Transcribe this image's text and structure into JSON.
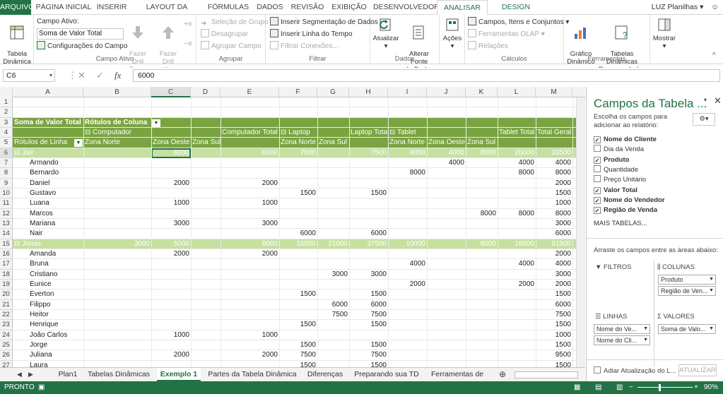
{
  "ribbon": {
    "tabs": [
      "ARQUIVO",
      "PÁGINA INICIAL",
      "INSERIR",
      "LAYOUT DA PÁGINA",
      "FÓRMULAS",
      "DADOS",
      "REVISÃO",
      "EXIBIÇÃO",
      "DESENVOLVEDOR",
      "ANALISAR",
      "DESIGN"
    ],
    "active_tab": "ANALISAR",
    "user": "LUZ Planilhas",
    "table_dynamic": "Tabela\nDinâmica",
    "campo_ativo_label": "Campo Ativo:",
    "campo_ativo_value": "Soma de Valor Total",
    "config_campo": "Configurações do Campo",
    "fazer_drill_down": "Fazer Drill\nDown",
    "fazer_drill_up": "Fazer Drill\nUp",
    "grp_campo_ativo": "Campo Ativo",
    "selecao_grupo": "Seleção de Grupo",
    "desagrupar": "Desagrupar",
    "agrupar_campo": "Agrupar Campo",
    "grp_agrupar": "Agrupar",
    "inserir_segmentacao": "Inserir Segmentação de Dados",
    "inserir_linha_tempo": "Inserir Linha do Tempo",
    "filtrar_conexoes": "Filtrar Conexões...",
    "grp_filtrar": "Filtrar",
    "atualizar": "Atualizar",
    "alterar_fonte": "Alterar Fonte\nde Dados",
    "grp_dados": "Dados",
    "acoes": "Ações",
    "campos_itens": "Campos, Itens e Conjuntos",
    "ferramentas_olap": "Ferramentas OLAP",
    "relacoes": "Relações",
    "grp_calculos": "Cálculos",
    "grafico_dinamico": "Gráfico\nDinâmico",
    "tabelas_recomendadas": "Tabelas Dinâmicas\nRecomendadas",
    "grp_ferramentas": "Ferramentas",
    "mostrar": "Mostrar"
  },
  "formula_bar": {
    "name_box": "C6",
    "value": "6000",
    "fx": "fx"
  },
  "columns": [
    "A",
    "B",
    "C",
    "D",
    "E",
    "F",
    "G",
    "H",
    "I",
    "J",
    "K",
    "L",
    "M"
  ],
  "rows": [
    {
      "n": "1",
      "cells": {}
    },
    {
      "n": "2",
      "cells": {}
    },
    {
      "n": "3",
      "style": "dark",
      "cells": {
        "A": "Soma de Valor Total",
        "B": "Rótulos de Coluna"
      }
    },
    {
      "n": "4",
      "style": "med",
      "cells": {
        "A": "",
        "B": "⊟ Computador",
        "E": "Computador Total",
        "F": "⊟ Laptop",
        "H": "Laptop Total",
        "I": "⊟ Tablet",
        "L": "Tablet Total",
        "M": "Total Geral"
      }
    },
    {
      "n": "5",
      "style": "med",
      "cells": {
        "A": "Rótulos de Linha",
        "B": "Zona Norte",
        "C": "Zona Oeste",
        "D": "Zona Sul",
        "F": "Zona Norte",
        "G": "Zona Sul",
        "I": "Zona Norte",
        "J": "Zona Oeste",
        "K": "Zona Sul"
      }
    },
    {
      "n": "6",
      "style": "light",
      "cells": {
        "A": "⊟ Jair",
        "C": "6000",
        "E": "6000",
        "F": "7500",
        "H": "7500",
        "I": "8000",
        "J": "4000",
        "K": "8000",
        "L": "20000",
        "M": "33500"
      }
    },
    {
      "n": "7",
      "cells": {
        "A": "Armando",
        "J": "4000",
        "L": "4000",
        "M": "4000"
      }
    },
    {
      "n": "8",
      "cells": {
        "A": "Bernardo",
        "I": "8000",
        "L": "8000",
        "M": "8000"
      }
    },
    {
      "n": "9",
      "cells": {
        "A": "Daniel",
        "C": "2000",
        "E": "2000",
        "M": "2000"
      }
    },
    {
      "n": "10",
      "cells": {
        "A": "Gustavo",
        "F": "1500",
        "H": "1500",
        "M": "1500"
      }
    },
    {
      "n": "11",
      "cells": {
        "A": "Luana",
        "C": "1000",
        "E": "1000",
        "M": "1000"
      }
    },
    {
      "n": "12",
      "cells": {
        "A": "Marcos",
        "K": "8000",
        "L": "8000",
        "M": "8000"
      }
    },
    {
      "n": "13",
      "cells": {
        "A": "Mariana",
        "C": "3000",
        "E": "3000",
        "M": "3000"
      }
    },
    {
      "n": "14",
      "cells": {
        "A": "Nair",
        "F": "6000",
        "H": "6000",
        "M": "6000"
      }
    },
    {
      "n": "15",
      "style": "light",
      "cells": {
        "A": "⊟ Jonas",
        "B": "3000",
        "C": "5000",
        "E": "8000",
        "F": "16500",
        "G": "21000",
        "H": "37500",
        "I": "10000",
        "K": "6000",
        "L": "16000",
        "M": "61500"
      }
    },
    {
      "n": "16",
      "cells": {
        "A": "Amanda",
        "C": "2000",
        "E": "2000",
        "M": "2000"
      }
    },
    {
      "n": "17",
      "cells": {
        "A": "Bruna",
        "I": "4000",
        "L": "4000",
        "M": "4000"
      }
    },
    {
      "n": "18",
      "cells": {
        "A": "Cristiano",
        "G": "3000",
        "H": "3000",
        "M": "3000"
      }
    },
    {
      "n": "19",
      "cells": {
        "A": "Eunice",
        "I": "2000",
        "L": "2000",
        "M": "2000"
      }
    },
    {
      "n": "20",
      "cells": {
        "A": "Everton",
        "F": "1500",
        "H": "1500",
        "M": "1500"
      }
    },
    {
      "n": "21",
      "cells": {
        "A": "Filippo",
        "G": "6000",
        "H": "6000",
        "M": "6000"
      }
    },
    {
      "n": "22",
      "cells": {
        "A": "Heitor",
        "G": "7500",
        "H": "7500",
        "M": "7500"
      }
    },
    {
      "n": "23",
      "cells": {
        "A": "Henrique",
        "F": "1500",
        "H": "1500",
        "M": "1500"
      }
    },
    {
      "n": "24",
      "cells": {
        "A": "João Carlos",
        "C": "1000",
        "E": "1000",
        "M": "1000"
      }
    },
    {
      "n": "25",
      "cells": {
        "A": "Jorge",
        "F": "1500",
        "H": "1500",
        "M": "1500"
      }
    },
    {
      "n": "26",
      "cells": {
        "A": "Juliana",
        "C": "2000",
        "E": "2000",
        "F": "7500",
        "H": "7500",
        "M": "9500"
      }
    },
    {
      "n": "27",
      "cells": {
        "A": "Laura",
        "F": "1500",
        "H": "1500",
        "M": "1500"
      }
    }
  ],
  "sheet_tabs": [
    "Plan1",
    "Tabelas Dinâmicas",
    "Exemplo 1",
    "Partes da Tabela Dinâmica",
    "Diferenças",
    "Preparando sua TD",
    "Ferramentas de"
  ],
  "active_sheet": "Exemplo 1",
  "status": {
    "mode": "PRONTO",
    "zoom": "90%"
  },
  "pivot_pane": {
    "title": "Campos da Tabela ...",
    "subtitle": "Escolha os campos para adicionar ao relatório:",
    "fields": [
      {
        "name": "Nome do Cliente",
        "checked": true
      },
      {
        "name": "Dia da Venda",
        "checked": false
      },
      {
        "name": "Produto",
        "checked": true
      },
      {
        "name": "Quantidade",
        "checked": false
      },
      {
        "name": "Preço Unitário",
        "checked": false
      },
      {
        "name": "Valor Total",
        "checked": true
      },
      {
        "name": "Nome do Vendedor",
        "checked": true
      },
      {
        "name": "Região de Venda",
        "checked": true
      }
    ],
    "more_tables": "MAIS TABELAS...",
    "drag_hint": "Arraste os campos entre as áreas abaixo:",
    "filters_label": "FILTROS",
    "columns_label": "COLUNAS",
    "rows_label": "LINHAS",
    "values_label": "VALORES",
    "columns_items": [
      "Produto",
      "Região de Ven..."
    ],
    "rows_items": [
      "Nome do Ve...",
      "Nome do Cli..."
    ],
    "values_items": [
      "Soma de Valo..."
    ],
    "defer_update": "Adiar Atualização do L...",
    "update_button": "ATUALIZAR"
  }
}
